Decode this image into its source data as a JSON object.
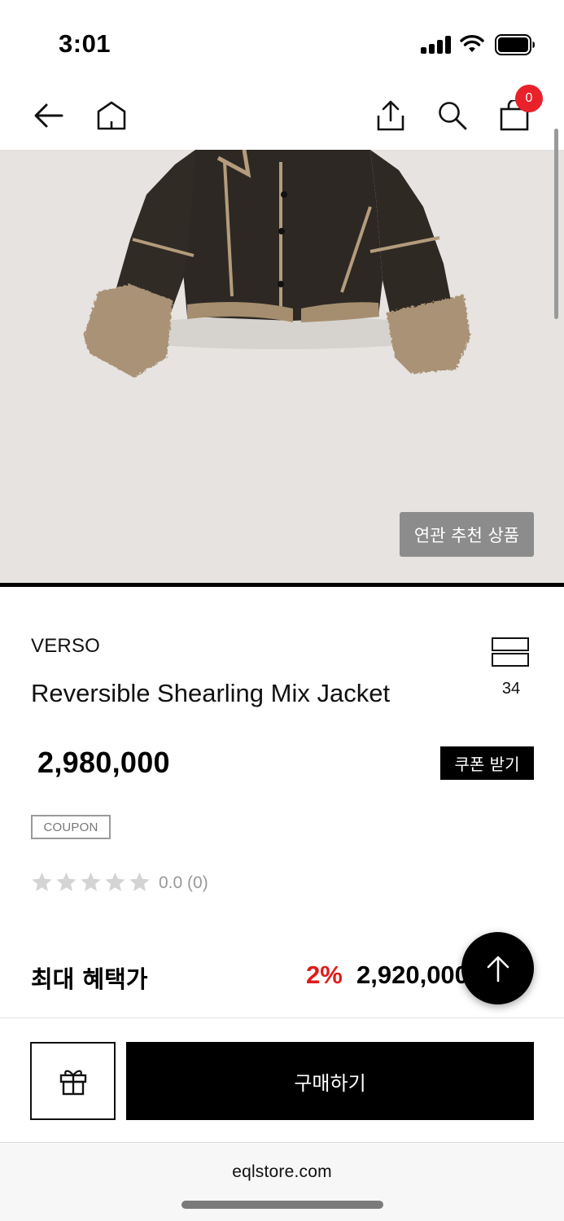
{
  "status_bar": {
    "time": "3:01",
    "signal_icon": "cellular-signal-icon",
    "wifi_icon": "wifi-icon",
    "battery_icon": "battery-icon"
  },
  "nav": {
    "back_icon": "arrow-left-icon",
    "home_icon": "home-icon",
    "share_icon": "share-icon",
    "search_icon": "search-icon",
    "cart_icon": "shopping-bag-icon",
    "cart_count": "0"
  },
  "product_image": {
    "related_label": "연관 추천 상품",
    "background_color": "#e6e3e0"
  },
  "product": {
    "brand": "VERSO",
    "name": "Reversible Shearling Mix Jacket",
    "layout_count": "34",
    "price": "2,980,000",
    "coupon_button_label": "쿠폰 받기",
    "coupon_tag": "COUPON",
    "rating_stars": 0,
    "rating_text": "0.0 (0)"
  },
  "benefit": {
    "label": "최대 혜택가",
    "percent": "2%",
    "price": "2,920,000"
  },
  "actions": {
    "gift_icon": "gift-icon",
    "buy_label": "구매하기",
    "scroll_top_icon": "arrow-up-icon"
  },
  "browser": {
    "url": "eqlstore.com"
  },
  "colors": {
    "accent_red": "#e01b1b",
    "badge_red": "#e8212b",
    "button_black": "#000000",
    "related_button_gray": "#8c8c8c"
  }
}
